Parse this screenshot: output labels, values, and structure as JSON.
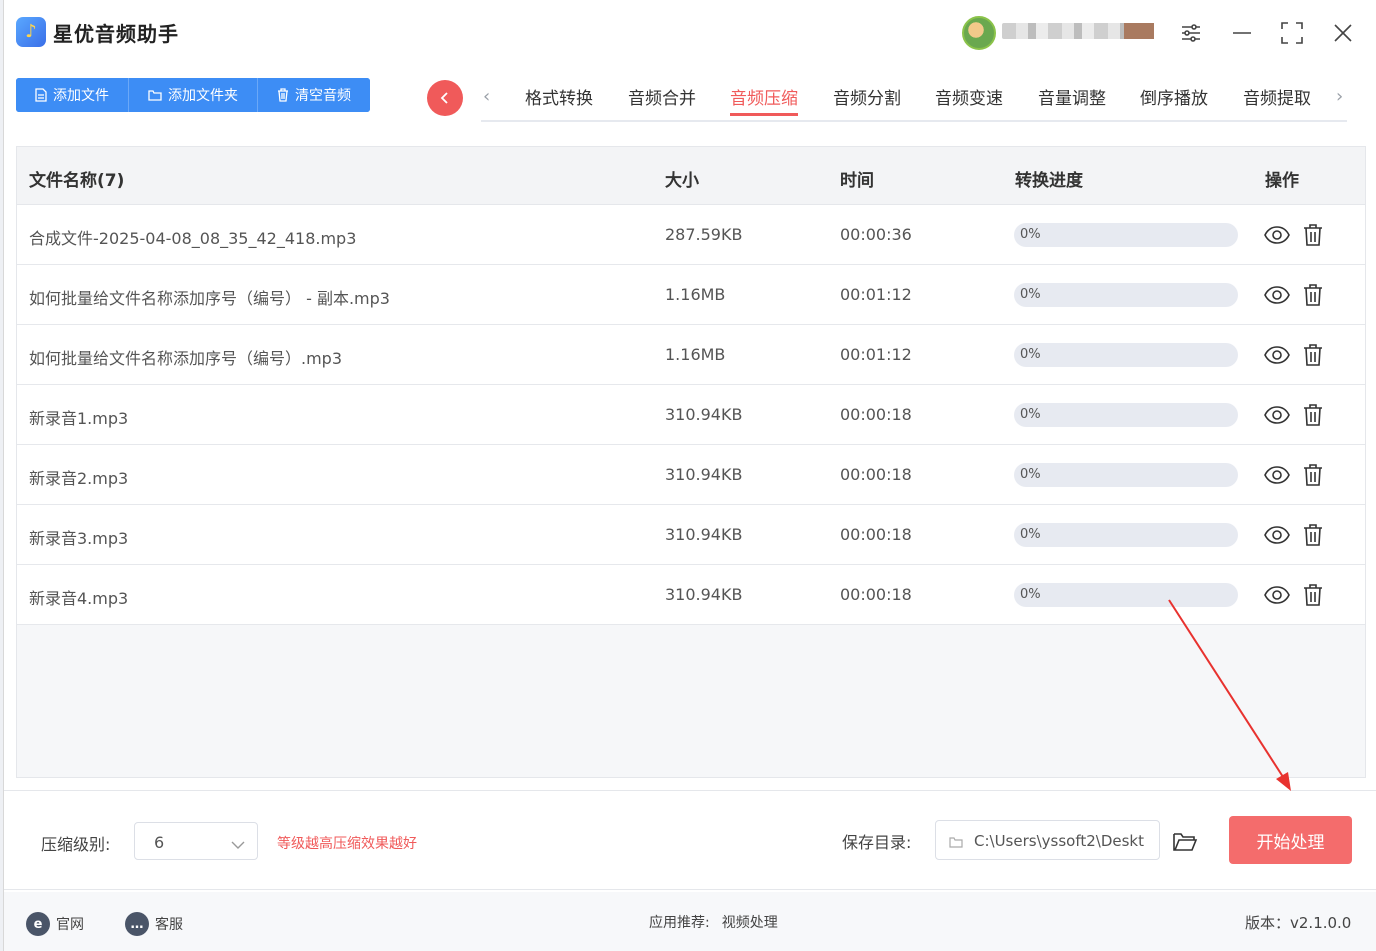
{
  "app": {
    "title": "星优音频助手",
    "logo_icon": "music-note-icon"
  },
  "titlebar": {
    "controls": [
      "settings-sliders-icon",
      "minimize-icon",
      "maximize-icon",
      "close-icon"
    ]
  },
  "toolbar": {
    "add_file": "添加文件",
    "add_folder": "添加文件夹",
    "clear": "清空音频"
  },
  "tabs": [
    {
      "label": "格式转换",
      "active": false
    },
    {
      "label": "音频合并",
      "active": false
    },
    {
      "label": "音频压缩",
      "active": true
    },
    {
      "label": "音频分割",
      "active": false
    },
    {
      "label": "音频变速",
      "active": false
    },
    {
      "label": "音量调整",
      "active": false
    },
    {
      "label": "倒序播放",
      "active": false
    },
    {
      "label": "音频提取",
      "active": false
    }
  ],
  "table": {
    "headers": {
      "name": "文件名称(7)",
      "size": "大小",
      "time": "时间",
      "progress": "转换进度",
      "ops": "操作"
    },
    "rows": [
      {
        "name": "合成文件-2025-04-08_08_35_42_418.mp3",
        "size": "287.59KB",
        "time": "00:00:36",
        "progress": "0%",
        "progress_value": 0
      },
      {
        "name": "如何批量给文件名称添加序号（编号） - 副本.mp3",
        "size": "1.16MB",
        "time": "00:01:12",
        "progress": "0%",
        "progress_value": 0
      },
      {
        "name": "如何批量给文件名称添加序号（编号）.mp3",
        "size": "1.16MB",
        "time": "00:01:12",
        "progress": "0%",
        "progress_value": 0
      },
      {
        "name": "新录音1.mp3",
        "size": "310.94KB",
        "time": "00:00:18",
        "progress": "0%",
        "progress_value": 0
      },
      {
        "name": "新录音2.mp3",
        "size": "310.94KB",
        "time": "00:00:18",
        "progress": "0%",
        "progress_value": 0
      },
      {
        "name": "新录音3.mp3",
        "size": "310.94KB",
        "time": "00:00:18",
        "progress": "0%",
        "progress_value": 0
      },
      {
        "name": "新录音4.mp3",
        "size": "310.94KB",
        "time": "00:00:18",
        "progress": "0%",
        "progress_value": 0
      }
    ]
  },
  "settings": {
    "level_label": "压缩级别:",
    "level_value": "6",
    "level_hint": "等级越高压缩效果越好",
    "save_label": "保存目录:",
    "save_path": "C:\\Users\\yssoft2\\Deskt",
    "start_button": "开始处理"
  },
  "footer": {
    "website": "官网",
    "support": "客服",
    "recommend_label": "应用推荐:",
    "recommend_value": "视频处理",
    "version": "版本：v2.1.0.0"
  },
  "colors": {
    "accent_blue": "#3d8df5",
    "accent_red": "#f05a5a",
    "start_button": "#f46c6c"
  }
}
